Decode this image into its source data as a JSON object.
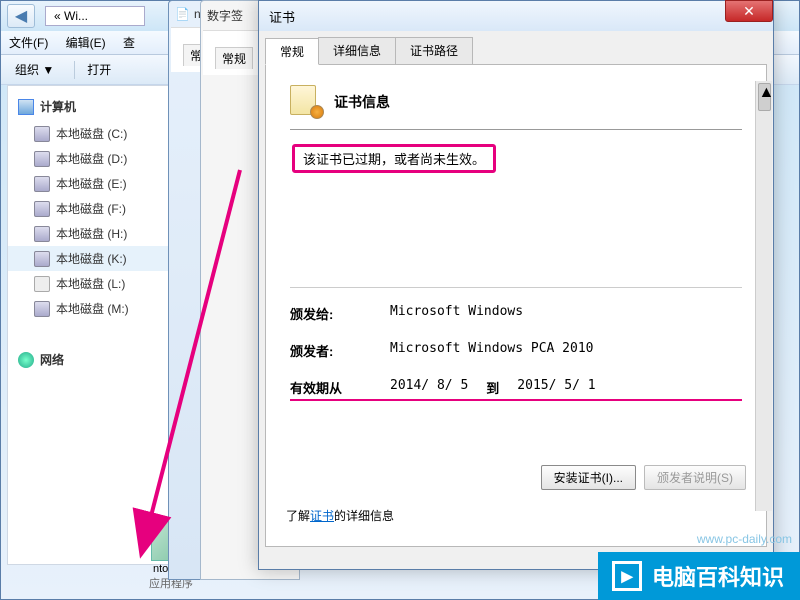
{
  "explorer": {
    "breadcrumb": "« Wi...",
    "menu": {
      "file": "文件(F)",
      "edit": "编辑(E)",
      "view": "查"
    },
    "toolbar": {
      "organize": "组织 ▼",
      "open": "打开"
    },
    "sidebar": {
      "computer": "计算机",
      "drives": [
        "本地磁盘 (C:)",
        "本地磁盘 (D:)",
        "本地磁盘 (E:)",
        "本地磁盘 (F:)",
        "本地磁盘 (H:)",
        "本地磁盘 (K:)",
        "本地磁盘 (L:)",
        "本地磁盘 (M:)"
      ],
      "network": "网络"
    },
    "file": {
      "name": "ntoskrn",
      "type": "应用程序"
    }
  },
  "stack": {
    "win1": "nt...",
    "win2": "数字签",
    "tab_partial": "常规",
    "tab_partial2": "常规"
  },
  "cert": {
    "title": "证书",
    "tabs": {
      "general": "常规",
      "details": "详细信息",
      "path": "证书路径"
    },
    "info_title": "证书信息",
    "status": "该证书已过期，或者尚未生效。",
    "issued_to_label": "颁发给:",
    "issued_to_value": "Microsoft Windows",
    "issued_by_label": "颁发者:",
    "issued_by_value": "Microsoft Windows PCA 2010",
    "valid_label": "有效期从",
    "valid_from": "2014/ 8/ 5",
    "valid_to_label": "到",
    "valid_to": "2015/ 5/ 1",
    "install_btn": "安装证书(I)...",
    "issuer_btn": "颁发者说明(S)",
    "footer_prefix": "了解",
    "footer_link": "证书",
    "footer_suffix": "的详细信息"
  },
  "watermark": {
    "text_prefix": "电脑百科知识",
    "url": "www.pc-daily.com"
  }
}
